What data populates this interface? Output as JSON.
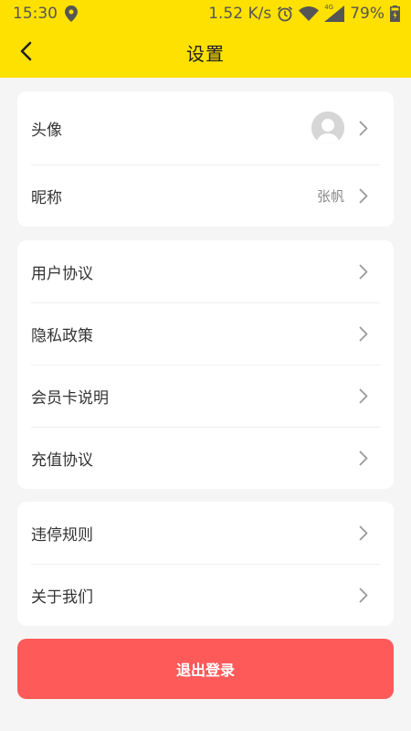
{
  "status_bar": {
    "time": "15:30",
    "net_speed": "1.52 K/s",
    "network_type": "4G",
    "battery": "79%",
    "icons": [
      "location-icon",
      "alarm-icon",
      "wifi-icon",
      "signal-icon",
      "battery-charging-icon"
    ]
  },
  "nav": {
    "title": "设置",
    "back_icon": "chevron-left-icon"
  },
  "profile_section": {
    "avatar_label": "头像",
    "nickname_label": "昵称",
    "nickname_value": "张帆"
  },
  "agreements_section": {
    "items": [
      {
        "label": "用户协议"
      },
      {
        "label": "隐私政策"
      },
      {
        "label": "会员卡说明"
      },
      {
        "label": "充值协议"
      }
    ]
  },
  "about_section": {
    "items": [
      {
        "label": "违停规则"
      },
      {
        "label": "关于我们"
      }
    ]
  },
  "logout_label": "退出登录",
  "colors": {
    "header_bg": "#ffe100",
    "logout_bg": "#ff5a5a",
    "page_bg": "#f5f5f5"
  }
}
